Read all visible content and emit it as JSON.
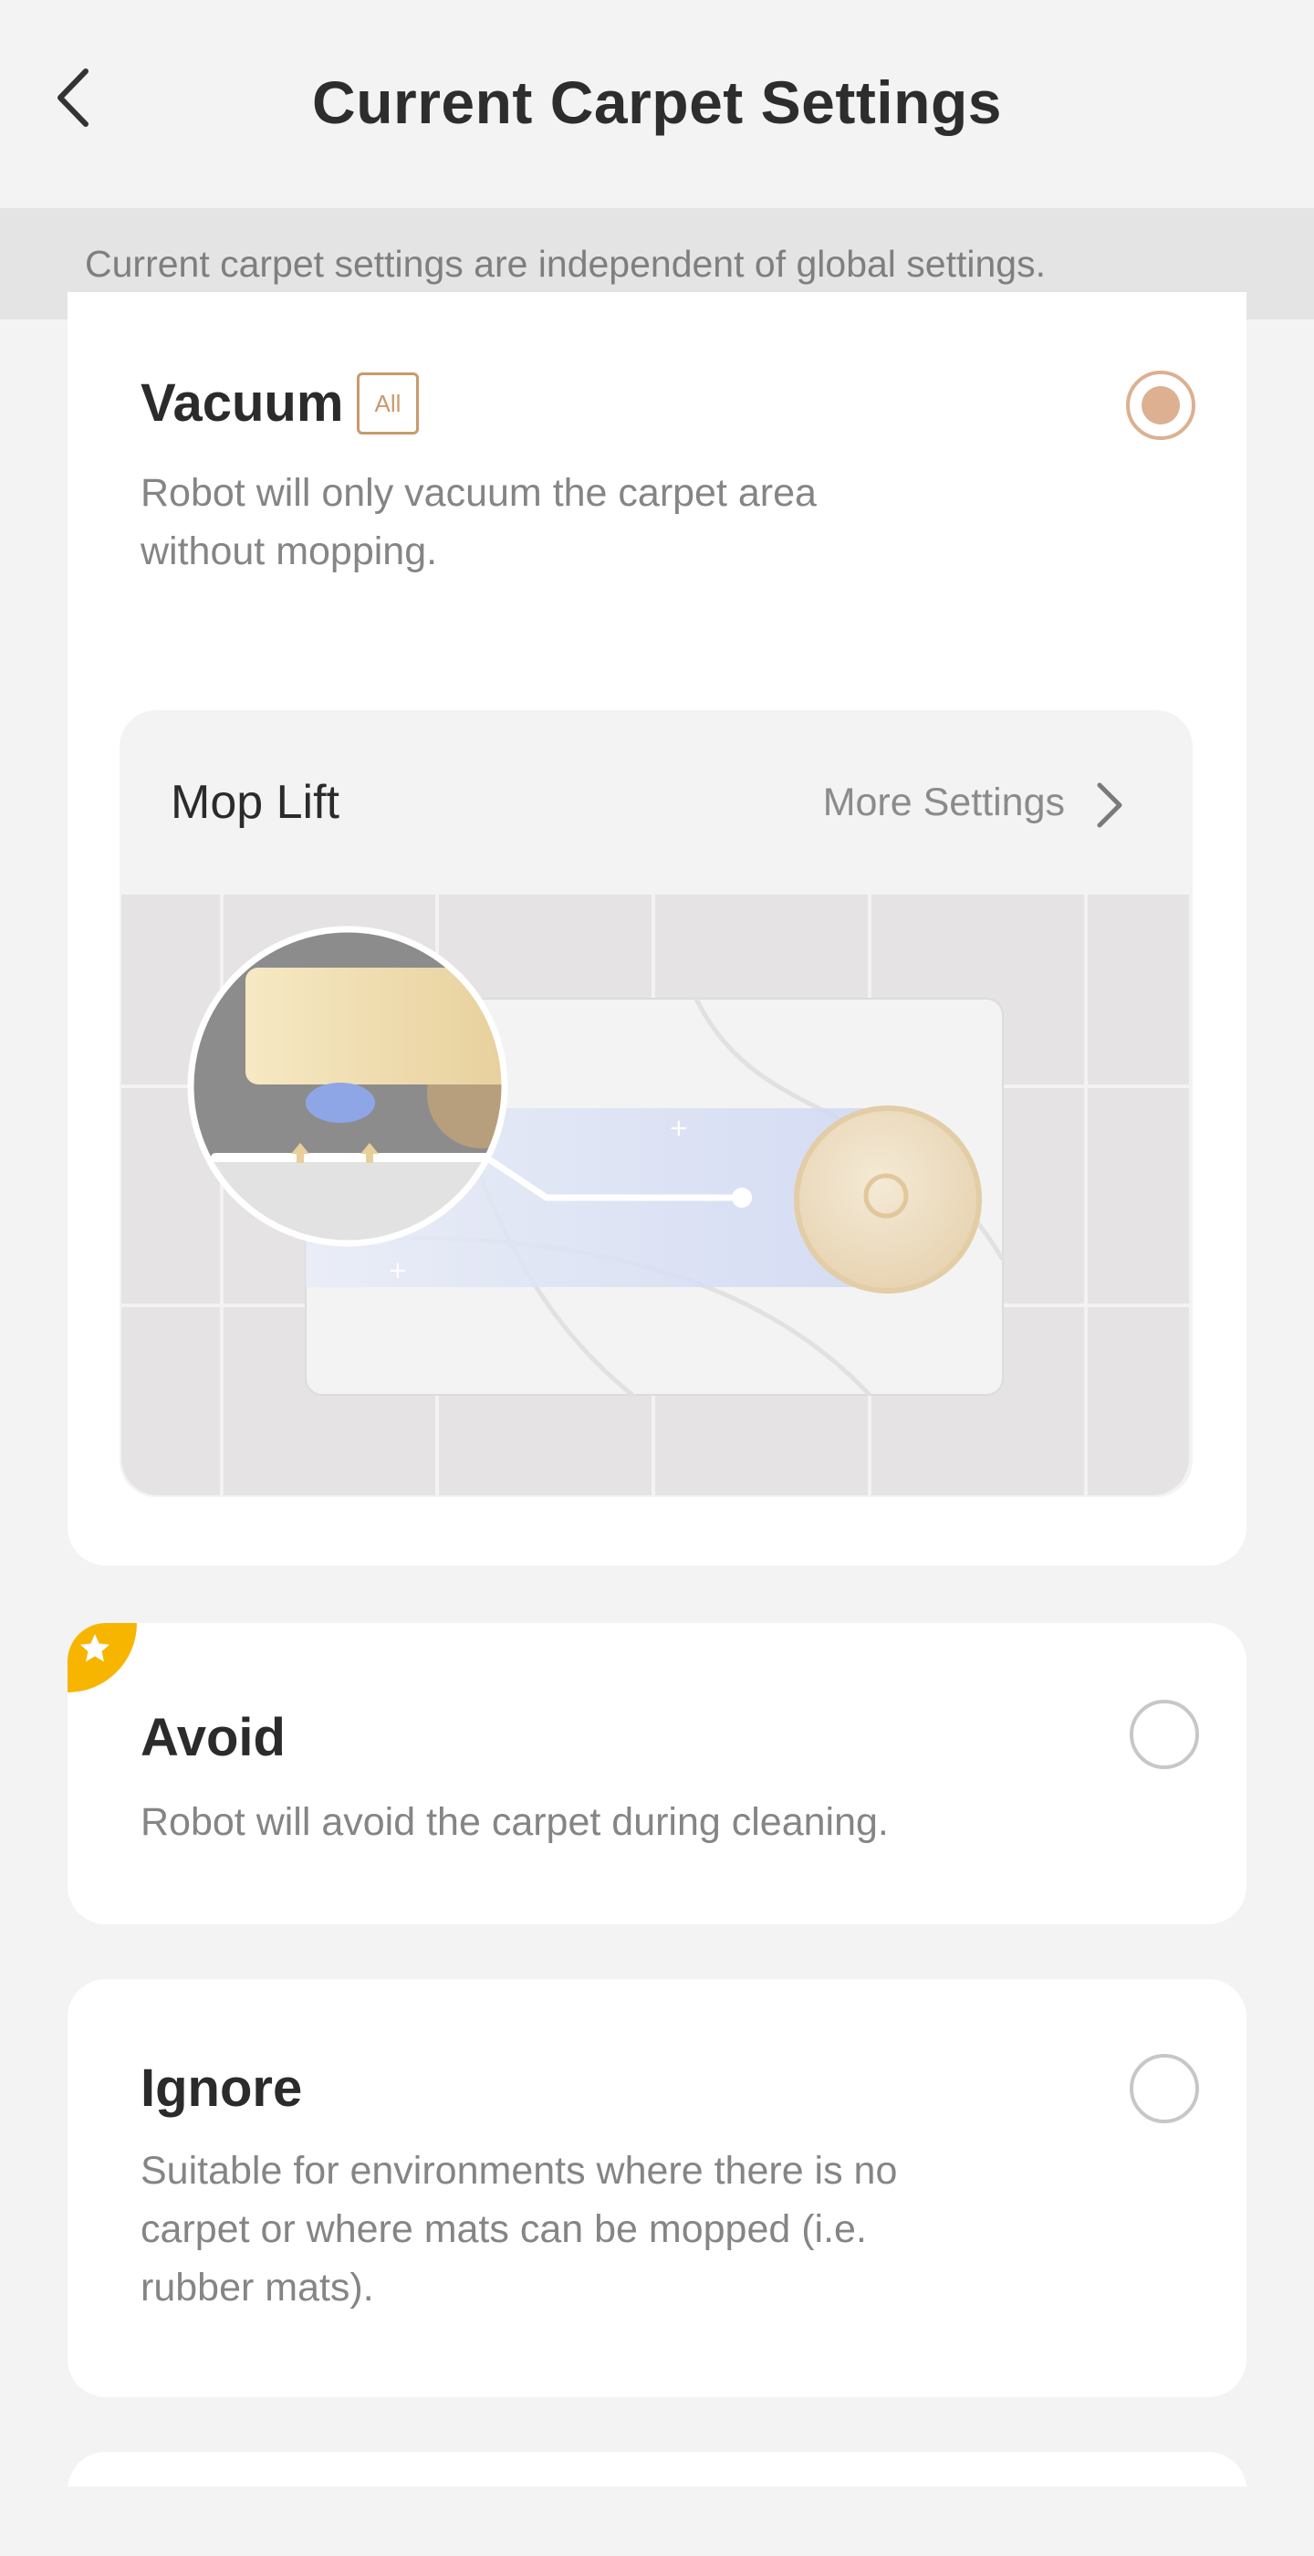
{
  "header": {
    "title": "Current Carpet Settings"
  },
  "notice": {
    "text": "Current carpet settings are independent of global settings."
  },
  "options": {
    "vacuum": {
      "title": "Vacuum",
      "badge": "All",
      "description": "Robot will only vacuum the carpet area without mopping.",
      "selected": true
    },
    "avoid": {
      "title": "Avoid",
      "description": "Robot will avoid the carpet during cleaning.",
      "selected": false
    },
    "ignore": {
      "title": "Ignore",
      "description": "Suitable for environments where there is no carpet or where mats can be mopped (i.e. rubber mats).",
      "selected": false
    }
  },
  "mop_lift": {
    "label": "Mop Lift",
    "more_settings": "More Settings"
  },
  "icons": {
    "back": "chevron-left-icon",
    "more": "chevron-right-icon",
    "ribbon": "star-icon"
  },
  "colors": {
    "accent": "#dcb090",
    "badge": "#c99a6b",
    "ribbon": "#f7b500",
    "background": "#f3f3f3",
    "notice_bg": "#e4e4e4"
  }
}
